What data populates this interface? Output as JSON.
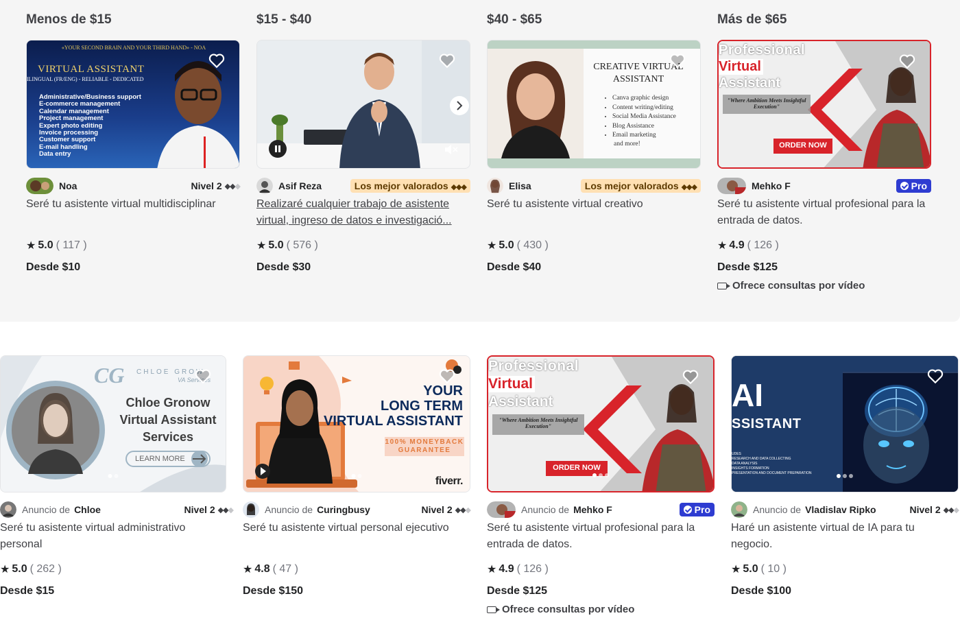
{
  "price_ranges": [
    "Menos de $15",
    "$15 - $40",
    "$40 - $65",
    "Más de $65"
  ],
  "featured": [
    {
      "seller": "Noa",
      "level": "Nivel 2",
      "title": "Seré tu asistente virtual multidisciplinar",
      "score": "5.0",
      "count": "( 117 )",
      "price": "Desde $10",
      "thumb": {
        "tagline": "«YOUR SECOND BRAIN AND YOUR THIRD HAND» - NOA",
        "heading": "VIRTUAL ASSISTANT",
        "sub": "ILINGUAL (FR/ENG) - RELIABLE - DEDICATED",
        "list": [
          "Administrative/Business support",
          "E-commerce management",
          "Calendar management",
          "Project management",
          "Expert photo editing",
          "Invoice processing",
          "Customer support",
          "E-mail handling",
          "Data entry"
        ]
      }
    },
    {
      "seller": "Asif Reza",
      "badge": "Los mejor valorados",
      "title": "Realizaré cualquier trabajo de asistente virtual, ingreso de datos e investigació...",
      "score": "5.0",
      "count": "( 576 )",
      "price": "Desde $30"
    },
    {
      "seller": "Elisa",
      "badge": "Los mejor valorados",
      "title": "Seré tu asistente virtual creativo",
      "score": "5.0",
      "count": "( 430 )",
      "price": "Desde $40",
      "thumb": {
        "heading1": "CREATIVE VIRTUAL",
        "heading2": "ASSISTANT",
        "list": [
          "Canva graphic design",
          "Content writing/editing",
          "Social Media Assistance",
          "Blog Assistance",
          "Email marketing"
        ],
        "more": "and more!"
      }
    },
    {
      "seller": "Mehko F",
      "pro": "Pro",
      "title": "Seré tu asistente virtual profesional para la entrada de datos.",
      "score": "4.9",
      "count": "( 126 )",
      "price": "Desde $125",
      "video": "Ofrece consultas por vídeo",
      "thumb": {
        "line1": "Professional",
        "line2": "Virtual",
        "line3": "Assistant",
        "quote": "\"Where Ambition Meets Insightful Execution\"",
        "cta": "ORDER NOW"
      }
    }
  ],
  "ads": [
    {
      "ad_label": "Anuncio de",
      "seller": "Chloe",
      "level": "Nivel 2",
      "title": "Seré tu asistente virtual administrativo personal",
      "score": "5.0",
      "count": "( 262 )",
      "price": "Desde $15",
      "thumb": {
        "logo": "CG",
        "brand": "CHLOE GROW",
        "brand_sub": "VA Services",
        "line1": "Chloe Gronow",
        "line2": "Virtual Assistant",
        "line3": "Services",
        "btn": "LEARN MORE"
      }
    },
    {
      "ad_label": "Anuncio de",
      "seller": "Curingbusy",
      "level": "Nivel 2",
      "title": "Seré tu asistente virtual personal ejecutivo",
      "score": "4.8",
      "count": "( 47 )",
      "price": "Desde $150",
      "thumb": {
        "line1": "YOUR",
        "line2": "LONG TERM",
        "line3": "VIRTUAL ASSISTANT",
        "g1": "100% MONEYBACK",
        "g2": "GUARANTEE",
        "logo": "fiverr."
      }
    },
    {
      "ad_label": "Anuncio de",
      "seller": "Mehko F",
      "pro": "Pro",
      "title": "Seré tu asistente virtual profesional para la entrada de datos.",
      "score": "4.9",
      "count": "( 126 )",
      "price": "Desde $125",
      "video": "Ofrece consultas por vídeo",
      "thumb": {
        "line1": "Professional",
        "line2": "Virtual",
        "line3": "Assistant",
        "quote": "\"Where Ambition Meets Insightful Execution\"",
        "cta": "ORDER NOW"
      }
    },
    {
      "ad_label": "Anuncio de",
      "seller": "Vladislav Ripko",
      "level": "Nivel 2",
      "title": "Haré un asistente virtual de IA para tu negocio.",
      "score": "5.0",
      "count": "( 10 )",
      "price": "Desde $100",
      "thumb": {
        "line1": "AI",
        "line2": "SSISTANT",
        "small1": "UDES",
        "small2": "RESEARCH AND DATA COLLECTING",
        "small3": "DATA ANALYSIS",
        "small4": "INSIGHTS FORMATION",
        "small5": "PRESENTATION AND DOCUMENT PREPARATION"
      }
    }
  ]
}
